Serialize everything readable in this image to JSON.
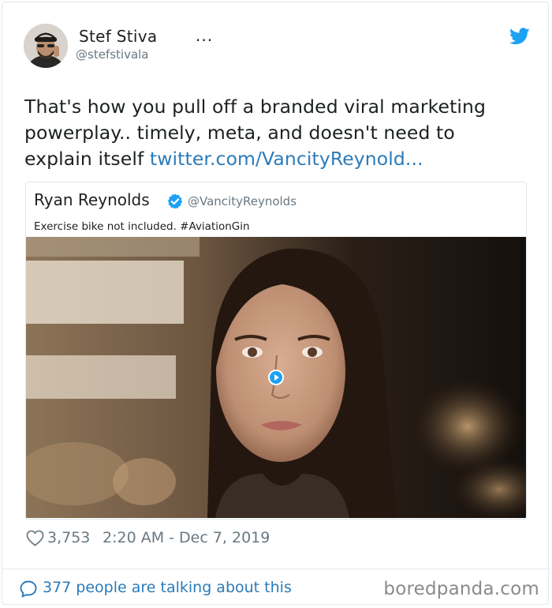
{
  "author": {
    "display_name": "Stef Stiva",
    "more": "...",
    "handle": "@stefstivala",
    "avatar_icon": "avatar-person",
    "bird_icon": "twitter-bird-icon"
  },
  "tweet": {
    "text": "That's how you pull off a branded viral marketing powerplay.. timely, meta, and doesn't need to explain itself ",
    "link": "twitter.com/VancityReynold..."
  },
  "quoted": {
    "display_name": "Ryan Reynolds",
    "handle": "@VancityReynolds",
    "text": "Exercise bike not included. #AviationGin",
    "verified_icon": "verified-badge-icon",
    "media_icon": "play-icon"
  },
  "meta": {
    "likes": "3,753",
    "timestamp": "2:20 AM - Dec 7, 2019"
  },
  "footer": {
    "talking": "377 people are talking about this",
    "watermark": "boredpanda.com"
  },
  "colors": {
    "link": "#2b7bb9",
    "twitter_blue": "#1da1f2",
    "secondary_text": "#697882",
    "border": "#e1e8ed"
  }
}
